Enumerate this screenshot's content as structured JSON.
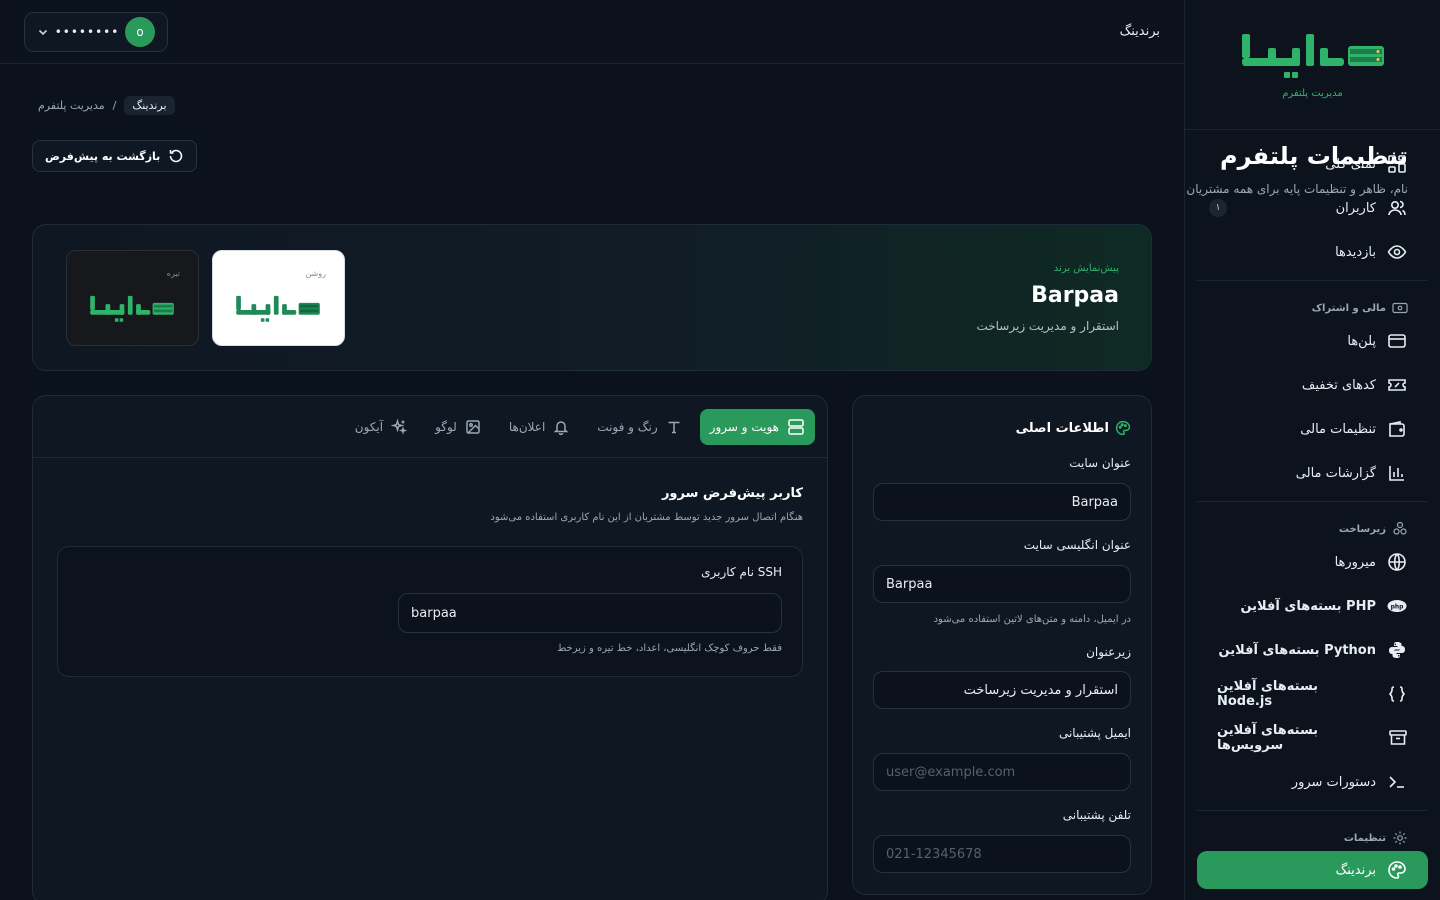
{
  "sidebar": {
    "logo_subtitle": "مدیریت پلتفرم",
    "items": [
      {
        "label": "نمای کلی",
        "icon": "grid-icon"
      },
      {
        "label": "کاربران",
        "icon": "users-icon",
        "badge": "۱"
      },
      {
        "label": "بازدیدها",
        "icon": "eye-icon"
      }
    ],
    "group_finance": "مالی و اشتراک",
    "finance_items": [
      {
        "label": "پلن‌ها",
        "icon": "card-icon"
      },
      {
        "label": "کدهای تخفیف",
        "icon": "ticket-icon"
      },
      {
        "label": "تنظیمات مالی",
        "icon": "wallet-icon"
      },
      {
        "label": "گزارشات مالی",
        "icon": "bar-chart-icon"
      }
    ],
    "group_infra": "زیرساخت",
    "infra_items": [
      {
        "label": "میرورها",
        "icon": "globe-icon"
      },
      {
        "label": "بسته‌های آفلاین PHP",
        "icon": "php-icon"
      },
      {
        "label": "بسته‌های آفلاین Python",
        "icon": "python-icon"
      },
      {
        "label": "بسته‌های آفلاین Node.js",
        "icon": "braces-icon"
      },
      {
        "label": "بسته‌های آفلاین سرویس‌ها",
        "icon": "archive-icon"
      },
      {
        "label": "دستورات سرور",
        "icon": "terminal-icon"
      }
    ],
    "group_settings": "تنظیمات",
    "active_item": "برندینگ"
  },
  "topbar": {
    "title": "برندینگ",
    "user_name": "••••••••",
    "avatar_letter": "o"
  },
  "breadcrumb": {
    "root": "مدیریت پلتفرم",
    "separator": "/",
    "current": "برندینگ"
  },
  "page": {
    "title": "تنظیمات پلتفرم",
    "subtitle": "نام، ظاهر و تنظیمات پایه برای همه مشتریان",
    "reset_label": "بازگشت به پیش‌فرض"
  },
  "brand_preview": {
    "kicker": "پیش‌نمایش برند",
    "name": "Barpaa",
    "description": "استقرار و مدیریت زیرساخت",
    "light_label": "روشن",
    "dark_label": "تیره"
  },
  "info": {
    "heading": "اطلاعات اصلی",
    "site_title_label": "عنوان سایت",
    "site_title_value": "Barpaa",
    "site_en_title_label": "عنوان انگلیسی سایت",
    "site_en_title_value": "Barpaa",
    "site_en_title_hint": "در ایمیل، دامنه و متن‌های لاتین استفاده می‌شود",
    "subtitle_label": "زیرعنوان",
    "subtitle_value": "استقرار و مدیریت زیرساخت",
    "email_label": "ایمیل پشتیبانی",
    "email_placeholder": "user@example.com",
    "phone_label": "تلفن پشتیبانی",
    "phone_placeholder": "021-12345678"
  },
  "tabs": [
    {
      "label": "هویت و سرور",
      "icon": "server-icon",
      "active": true
    },
    {
      "label": "رنگ و فونت",
      "icon": "type-icon"
    },
    {
      "label": "اعلان‌ها",
      "icon": "bell-icon"
    },
    {
      "label": "لوگو",
      "icon": "image-icon"
    },
    {
      "label": "آیکون",
      "icon": "sparkles-icon"
    }
  ],
  "server": {
    "title": "کاربر پیش‌فرض سرور",
    "subtitle": "هنگام اتصال سرور جدید توسط مشتریان از این نام کاربری استفاده می‌شود",
    "ssh_label": "نام کاربری SSH",
    "ssh_value": "barpaa",
    "ssh_hint": "فقط حروف کوچک انگلیسی، اعداد، خط تیره و زیرخط"
  },
  "colors": {
    "accent": "#2a9a5c",
    "accent_text": "#2fb36b",
    "background": "#0b121c"
  }
}
